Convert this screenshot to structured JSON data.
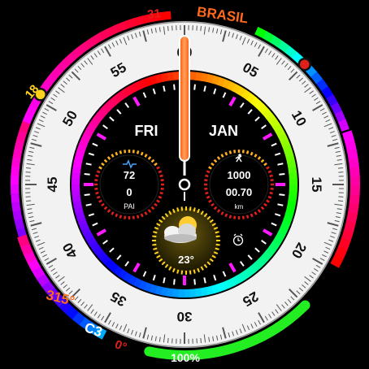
{
  "watch": {
    "location": "BRASIL",
    "date_top": "31",
    "left_value": "18",
    "compass_heading": "315°",
    "compass_code": "C3",
    "compass_zero": "0°",
    "battery_text": "100%",
    "battery_level": 1.0,
    "day": "FRI",
    "month": "JAN",
    "heart_rate": "72",
    "pai": "0",
    "pai_label": "PAI",
    "steps": "1000",
    "distance": "00.70",
    "distance_unit": "km",
    "temperature": "23°",
    "weather": "partly-cloudy-icon",
    "alarm": "alarm-clock-icon",
    "seconds_value": 0,
    "dial_numbers": [
      "60",
      "05",
      "10",
      "15",
      "20",
      "25",
      "30",
      "35",
      "40",
      "45",
      "50",
      "55"
    ],
    "colors": {
      "accent": "#ff6a1a",
      "red": "#e0201a",
      "green": "#22ee22",
      "magenta": "#ff1aff",
      "yellow": "#ffd21a"
    }
  }
}
